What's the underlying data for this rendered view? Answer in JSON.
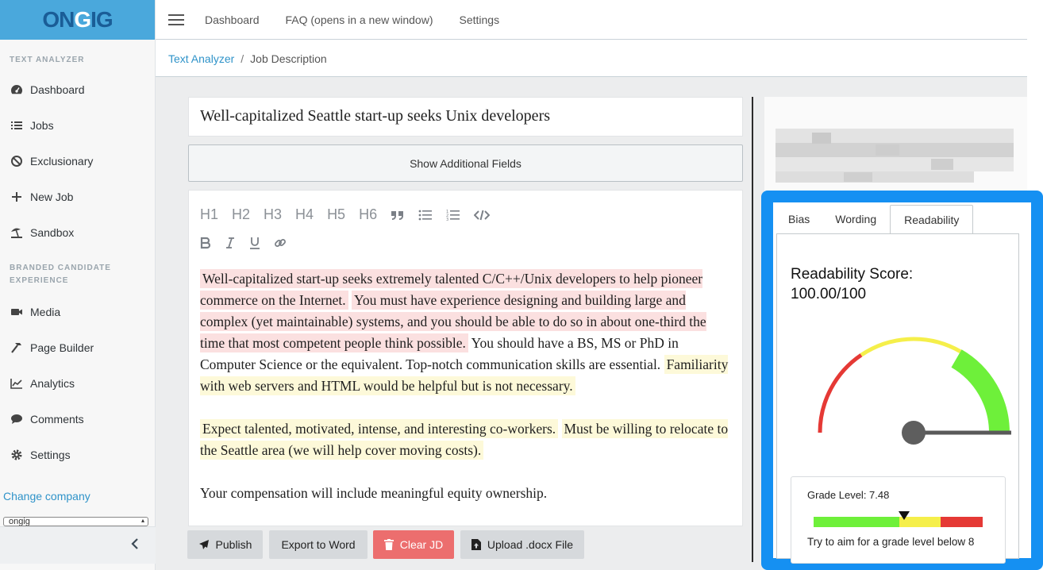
{
  "app": {
    "logo_dark_1": "ON",
    "logo_light": "G",
    "logo_dark_2": "IG"
  },
  "sidebar": {
    "section1_title": "TEXT ANALYZER",
    "items1": [
      {
        "label": "Dashboard",
        "icon": "dashboard-icon"
      },
      {
        "label": "Jobs",
        "icon": "list-icon"
      },
      {
        "label": "Exclusionary",
        "icon": "ban-icon"
      },
      {
        "label": "New Job",
        "icon": "plus-icon"
      },
      {
        "label": "Sandbox",
        "icon": "umbrella-beach-icon"
      }
    ],
    "section2_title": "BRANDED CANDIDATE EXPERIENCE",
    "items2": [
      {
        "label": "Media",
        "icon": "video-camera-icon"
      },
      {
        "label": "Page Builder",
        "icon": "hammer-icon"
      },
      {
        "label": "Analytics",
        "icon": "line-chart-icon"
      },
      {
        "label": "Comments",
        "icon": "comment-icon"
      },
      {
        "label": "Settings",
        "icon": "gear-icon"
      }
    ],
    "change_company": "Change company",
    "company_value": "ongig"
  },
  "topnav": {
    "links": [
      "Dashboard",
      "FAQ (opens in a new window)",
      "Settings"
    ]
  },
  "breadcrumb": {
    "parent": "Text Analyzer",
    "separator": "/",
    "current": "Job Description"
  },
  "editor": {
    "title": "Well-capitalized Seattle start-up seeks Unix developers",
    "show_fields_label": "Show Additional Fields",
    "toolbar_headings": [
      "H1",
      "H2",
      "H3",
      "H4",
      "H5",
      "H6"
    ],
    "paragraphs": {
      "p1_s1": "Well-capitalized start-up seeks extremely talented C/C++/Unix developers to help pioneer commerce on the Internet.",
      "p1_s2": "You must have experience designing and building large and complex (yet maintainable) systems, and you should be able to do so in about one-third the time that most competent people think possible.",
      "p1_s3": "You should have a BS, MS or PhD in Computer Science or the equivalent. Top-notch communication skills are essential.",
      "p1_s4": "Familiarity with web servers and HTML would be helpful but is not necessary.",
      "p2_s1": "Expect talented, motivated, intense, and interesting co-workers.",
      "p2_s2": "Must be willing to relocate to the Seattle area (we will help cover moving costs).",
      "p3_s1": "Your compensation will include meaningful equity ownership."
    }
  },
  "actions": {
    "publish": "Publish",
    "export": "Export to Word",
    "clear": "Clear JD",
    "upload": "Upload .docx File"
  },
  "panel": {
    "tabs": [
      "Bias",
      "Wording",
      "Readability"
    ],
    "active_tab": "Readability",
    "score_title": "Readability Score:",
    "score_value": "100.00/100",
    "score": 100,
    "grade_label": "Grade Level: 7.48",
    "grade_level": 7.48,
    "grade_hint": "Try to aim for a grade level below 8"
  },
  "colors": {
    "accent": "#2f93c9",
    "logo_bg": "#4aa8dc",
    "focus": "#1590f2",
    "highlight_red": "#fbe0e0",
    "highlight_yellow": "#fdf9d9",
    "gauge_red": "#e53935",
    "gauge_yellow": "#f5ef4a",
    "gauge_green": "#6ef03a",
    "clear_button": "#ec6e6e"
  }
}
